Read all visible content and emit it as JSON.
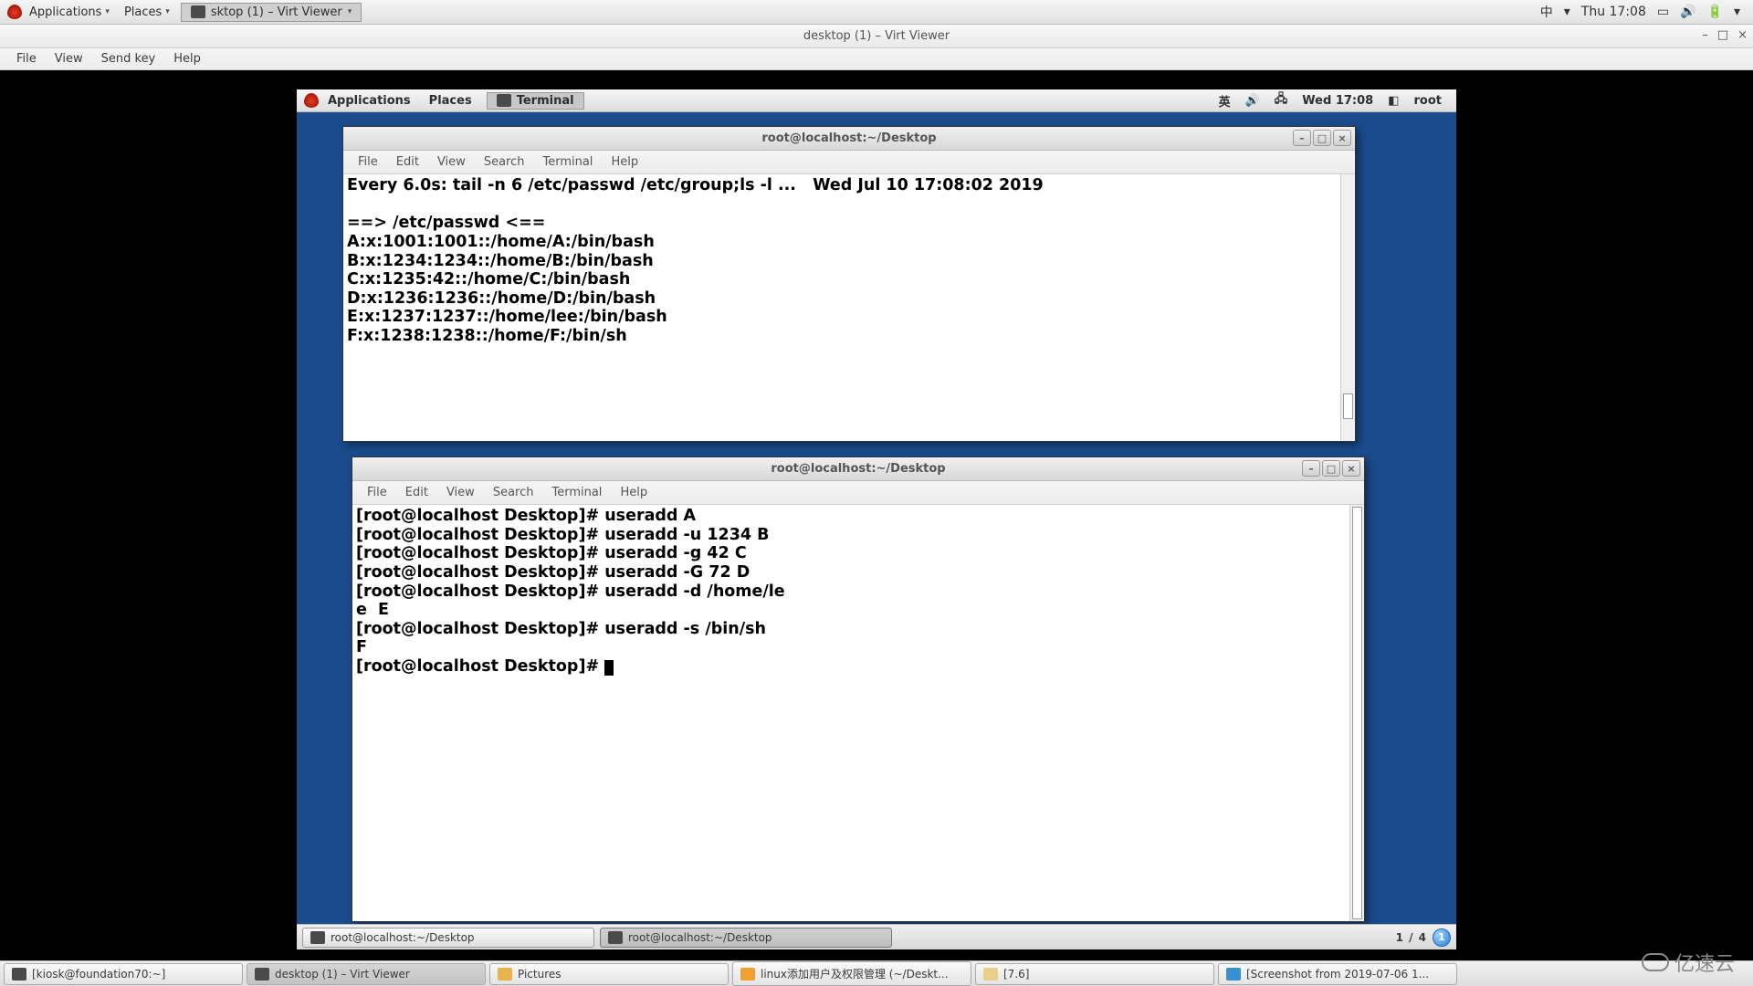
{
  "host_topbar": {
    "applications": "Applications",
    "places": "Places",
    "task_app": "sktop (1) – Virt Viewer",
    "input_indicator": "中",
    "clock": "Thu 17:08"
  },
  "viewer": {
    "title": "desktop (1) – Virt Viewer",
    "menu": {
      "file": "File",
      "view": "View",
      "sendkey": "Send key",
      "help": "Help"
    }
  },
  "guest_panel": {
    "applications": "Applications",
    "places": "Places",
    "terminal": "Terminal",
    "input": "英",
    "clock": "Wed 17:08",
    "user": "root"
  },
  "term1": {
    "title": "root@localhost:~/Desktop",
    "menu": {
      "file": "File",
      "edit": "Edit",
      "view": "View",
      "search": "Search",
      "terminal": "Terminal",
      "help": "Help"
    },
    "lines": [
      "Every 6.0s: tail -n 6 /etc/passwd /etc/group;ls -l ...   Wed Jul 10 17:08:02 2019",
      "",
      "==> /etc/passwd <==",
      "A:x:1001:1001::/home/A:/bin/bash",
      "B:x:1234:1234::/home/B:/bin/bash",
      "C:x:1235:42::/home/C:/bin/bash",
      "D:x:1236:1236::/home/D:/bin/bash",
      "E:x:1237:1237::/home/lee:/bin/bash",
      "F:x:1238:1238::/home/F:/bin/sh"
    ]
  },
  "term2": {
    "title": "root@localhost:~/Desktop",
    "menu": {
      "file": "File",
      "edit": "Edit",
      "view": "View",
      "search": "Search",
      "terminal": "Terminal",
      "help": "Help"
    },
    "lines": [
      "[root@localhost Desktop]# useradd A",
      "[root@localhost Desktop]# useradd -u 1234 B",
      "[root@localhost Desktop]# useradd -g 42 C",
      "[root@localhost Desktop]# useradd -G 72 D",
      "[root@localhost Desktop]# useradd -d /home/le",
      "e  E",
      "[root@localhost Desktop]# useradd -s /bin/sh ",
      "F",
      "[root@localhost Desktop]# "
    ]
  },
  "guest_taskbar": {
    "task1": "root@localhost:~/Desktop",
    "task2": "root@localhost:~/Desktop",
    "pager": "1 / 4",
    "badge": "1"
  },
  "host_taskbar": {
    "t1": "[kiosk@foundation70:~]",
    "t2": "desktop (1) – Virt Viewer",
    "t3": "Pictures",
    "t4": "linux添加用户及权限管理 (~/Deskt...",
    "t5": "[7.6]",
    "t6": "[Screenshot from 2019-07-06 1..."
  },
  "watermark": "亿速云"
}
